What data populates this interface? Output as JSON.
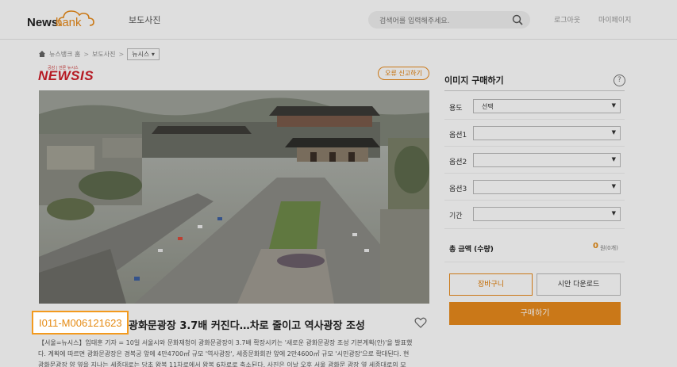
{
  "header": {
    "logo_news": "News",
    "logo_bank": "bank",
    "nav_photo": "보도사진",
    "search_placeholder": "검색어를 입력해주세요.",
    "logout": "로그아웃",
    "mypage": "마이페이지"
  },
  "breadcrumb": {
    "home": "뉴스뱅크 홈",
    "sep": ">",
    "section": "보도사진",
    "dropdown": "뉴시스 ▾"
  },
  "source": {
    "tagline": "공감 | 언론 뉴시스",
    "name": "NEWSIS"
  },
  "report_button": "오류 신고하기",
  "photo_code": "I011-M006121623",
  "title": "광화문광장 3.7배 커진다…차로 줄이고 역사광장 조성",
  "body_lines": [
    "【서울=뉴시스】임태훈 기자 = 10일 서울시와 문화재청이 광화문광장이 3.7배 확장시키는 '새로운 광화문광장 조성 기본계획(안)'을 발표했",
    "다. 계획에 따르면 광화문광장은 경복궁 앞에 4만4700㎡ 규모 '역사광장', 세종문화회관 앞에 2만4600㎡ 규모 '시민광장'으로 확대된다. 현",
    "광화문광장 양 옆을 지나는 세종대로는 당초 왕복 11차로에서 왕복 6차로로 축소된다. 사진은 이날 오후 서울 광화문 광장 옆 세종대로의 모"
  ],
  "purchase": {
    "title": "이미지 구매하기",
    "help": "?",
    "rows": [
      {
        "label": "용도",
        "value": "선택"
      },
      {
        "label": "옵션1",
        "value": ""
      },
      {
        "label": "옵션2",
        "value": ""
      },
      {
        "label": "옵션3",
        "value": ""
      },
      {
        "label": "기간",
        "value": ""
      }
    ],
    "arrow": "▼",
    "total_label": "총 금액 (수량)",
    "total_value": "0",
    "total_unit": "원(0개)",
    "cart": "장바구니",
    "sample": "시안 다운로드",
    "buy": "구매하기"
  },
  "colors": {
    "accent": "#e98a1c",
    "newsis_red": "#d11f2a"
  }
}
